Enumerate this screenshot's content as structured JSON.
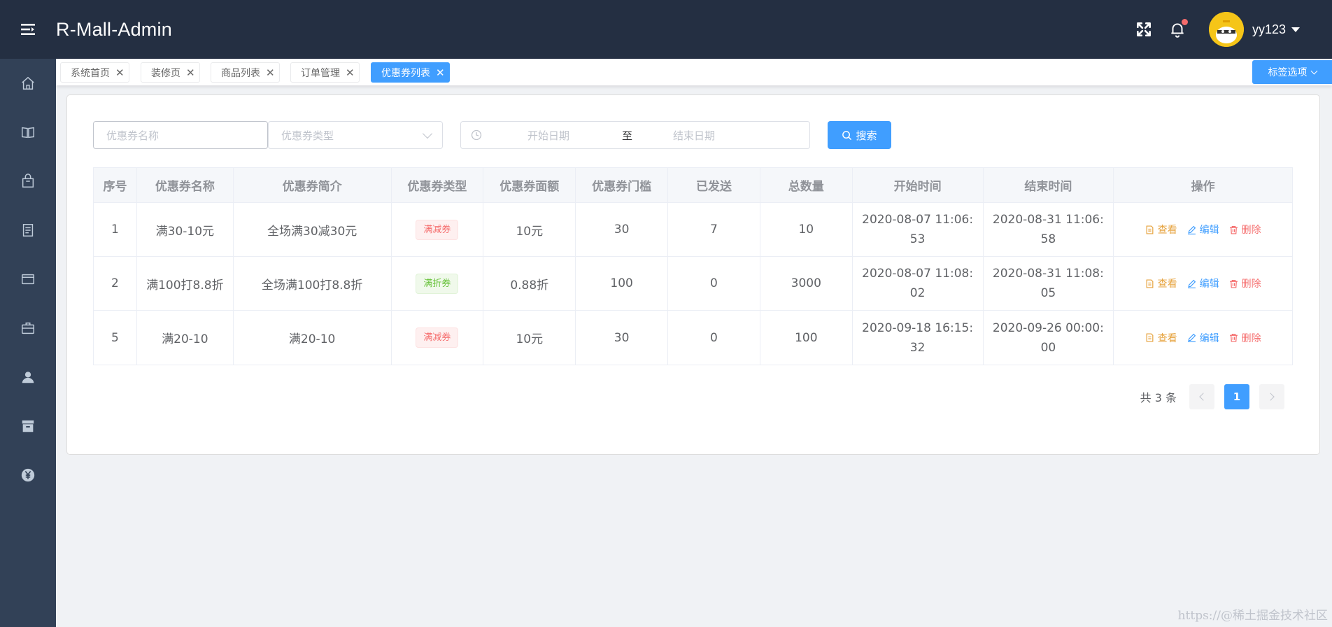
{
  "header": {
    "title": "R-Mall-Admin",
    "username": "yy123",
    "icons": [
      "menu-icon",
      "fullscreen-icon",
      "bell-icon"
    ]
  },
  "sidebar": {
    "items": [
      "home-icon",
      "book-icon",
      "bag-icon",
      "document-icon",
      "card-icon",
      "briefcase-icon",
      "user-icon",
      "archive-icon",
      "yen-icon"
    ]
  },
  "tabs": {
    "items": [
      {
        "label": "系统首页",
        "active": false
      },
      {
        "label": "装修页",
        "active": false
      },
      {
        "label": "商品列表",
        "active": false
      },
      {
        "label": "订单管理",
        "active": false
      },
      {
        "label": "优惠券列表",
        "active": true
      }
    ],
    "close_glyph": "✕",
    "options_label": "标签选项"
  },
  "filters": {
    "name_placeholder": "优惠券名称",
    "type_placeholder": "优惠券类型",
    "start_placeholder": "开始日期",
    "range_separator": "至",
    "end_placeholder": "结束日期",
    "search_label": "搜索"
  },
  "table": {
    "headers": [
      "序号",
      "优惠券名称",
      "优惠券简介",
      "优惠券类型",
      "优惠券面额",
      "优惠券门槛",
      "已发送",
      "总数量",
      "开始时间",
      "结束时间",
      "操作"
    ],
    "rows": [
      {
        "id": "1",
        "name": "满30-10元",
        "intro": "全场满30减30元",
        "type": "满减券",
        "type_color": "red",
        "amount": "10元",
        "threshold": "30",
        "sent": "7",
        "total": "10",
        "start": "2020-08-07 11:06:53",
        "end": "2020-08-31 11:06:58"
      },
      {
        "id": "2",
        "name": "满100打8.8折",
        "intro": "全场满100打8.8折",
        "type": "满折券",
        "type_color": "green",
        "amount": "0.88折",
        "threshold": "100",
        "sent": "0",
        "total": "3000",
        "start": "2020-08-07 11:08:02",
        "end": "2020-08-31 11:08:05"
      },
      {
        "id": "5",
        "name": "满20-10",
        "intro": "满20-10",
        "type": "满减券",
        "type_color": "red",
        "amount": "10元",
        "threshold": "30",
        "sent": "0",
        "total": "100",
        "start": "2020-09-18 16:15:32",
        "end": "2020-09-26 00:00:00"
      }
    ],
    "actions": {
      "view": "查看",
      "edit": "编辑",
      "delete": "删除"
    }
  },
  "pagination": {
    "total_label": "共 3 条",
    "current_page": "1"
  },
  "watermark": "https://@稀土掘金技术社区",
  "colors": {
    "header_bg": "#242f42",
    "sidebar_bg": "#324157",
    "primary": "#409eff"
  }
}
